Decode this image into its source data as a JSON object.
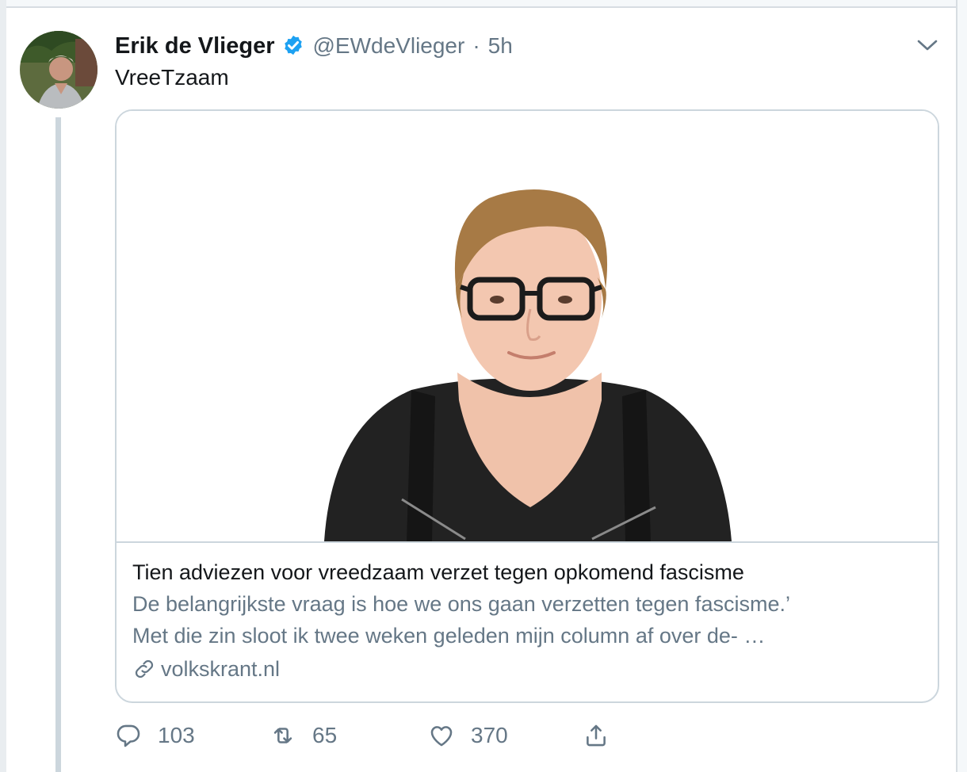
{
  "tweet": {
    "author_name": "Erik de Vlieger",
    "verified": true,
    "handle": "@EWdeVlieger",
    "separator": "·",
    "time": "5h",
    "text": "VreeTzaam"
  },
  "card": {
    "title": "Tien adviezen voor vreedzaam verzet tegen opkomend fascisme",
    "description_lines": [
      "De belangrijkste vraag is hoe we ons gaan verzetten tegen fascisme.’",
      "Met die zin sloot ik twee weken geleden mijn column af over de- …"
    ],
    "domain": "volkskrant.nl"
  },
  "actions": {
    "reply_count": "103",
    "retweet_count": "65",
    "like_count": "370"
  },
  "colors": {
    "text_primary": "#14171a",
    "text_secondary": "#657786",
    "verified_blue": "#1da1f2",
    "border": "#ccd6dd"
  },
  "icons": [
    "verified-badge-icon",
    "chevron-down-icon",
    "link-icon",
    "reply-icon",
    "retweet-icon",
    "like-icon",
    "share-icon"
  ]
}
